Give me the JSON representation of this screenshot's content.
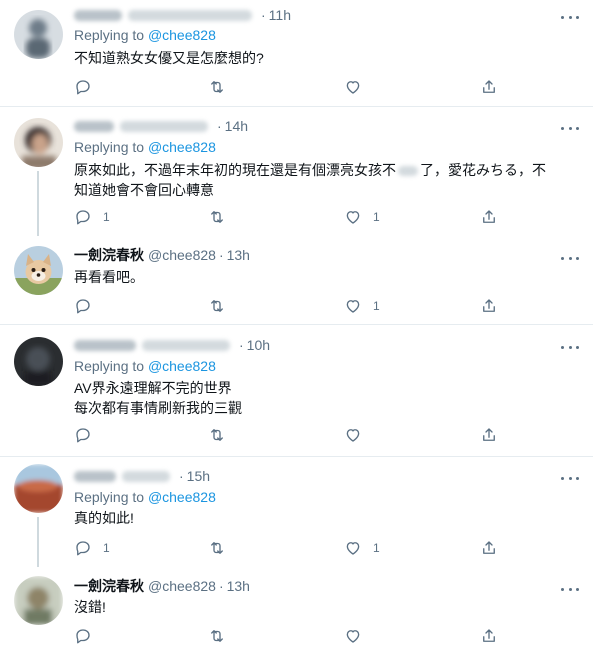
{
  "labels": {
    "replying_to": "Replying to",
    "mention": "@chee828"
  },
  "tweets": [
    {
      "name": "",
      "handle": "",
      "time": "11h",
      "text": [
        "不知道熟女女優又是怎麼想的?"
      ],
      "reply_count": "",
      "like_count": ""
    },
    {
      "name": "",
      "handle": "",
      "time": "14h",
      "text": [
        "原來如此，不過年末年初的現在還是有個漂亮女孩不",
        "了，愛花みちる，不",
        "知道她會不會回心轉意"
      ],
      "reply_count": "1",
      "like_count": "1"
    },
    {
      "name": "一劍浣春秋",
      "handle": "@chee828",
      "time": "13h",
      "text": [
        "再看看吧。"
      ],
      "reply_count": "",
      "like_count": "1"
    },
    {
      "name": "",
      "handle": "",
      "time": "10h",
      "text": [
        "AV界永遠理解不完的世界",
        "每次都有事情刷新我的三觀"
      ],
      "reply_count": "",
      "like_count": ""
    },
    {
      "name": "",
      "handle": "",
      "time": "15h",
      "text": [
        "真的如此!"
      ],
      "reply_count": "1",
      "like_count": "1"
    },
    {
      "name": "一劍浣春秋",
      "handle": "@chee828",
      "time": "13h",
      "text": [
        "沒錯!"
      ],
      "reply_count": "",
      "like_count": ""
    }
  ],
  "colors": {
    "link": "#1b95e0",
    "secondary": "#5b7083",
    "separator": "#e6ecf0"
  }
}
